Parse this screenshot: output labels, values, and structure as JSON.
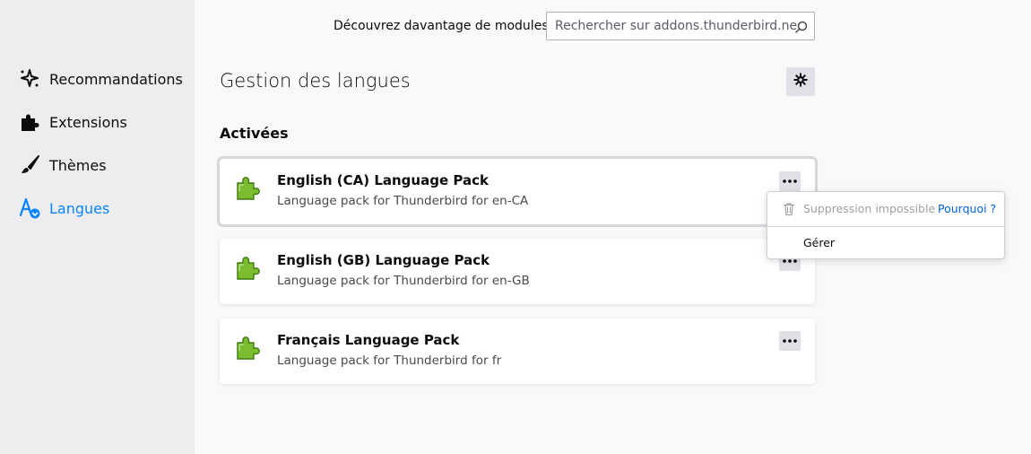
{
  "sidebar": {
    "items": [
      {
        "label": "Recommandations",
        "icon": "sparkle-icon"
      },
      {
        "label": "Extensions",
        "icon": "puzzle-icon"
      },
      {
        "label": "Thèmes",
        "icon": "brush-icon"
      },
      {
        "label": "Langues",
        "icon": "language-icon",
        "active": true
      }
    ]
  },
  "header": {
    "discover_label": "Découvrez davantage de modules",
    "search_placeholder": "Rechercher sur addons.thunderbird.net"
  },
  "main": {
    "title": "Gestion des langues",
    "section_title": "Activées",
    "addons": [
      {
        "name": "English (CA) Language Pack",
        "description": "Language pack for Thunderbird for en-CA"
      },
      {
        "name": "English (GB) Language Pack",
        "description": "Language pack for Thunderbird for en-GB"
      },
      {
        "name": "Français Language Pack",
        "description": "Language pack for Thunderbird for fr"
      }
    ]
  },
  "popup": {
    "remove_disabled": "Suppression impossible",
    "why_link": "Pourquoi ?",
    "manage": "Gérer"
  },
  "colors": {
    "accent": "#0a84ff",
    "link": "#0060df",
    "sidebar_bg": "#ededf0",
    "page_bg": "#f9f9fa"
  }
}
